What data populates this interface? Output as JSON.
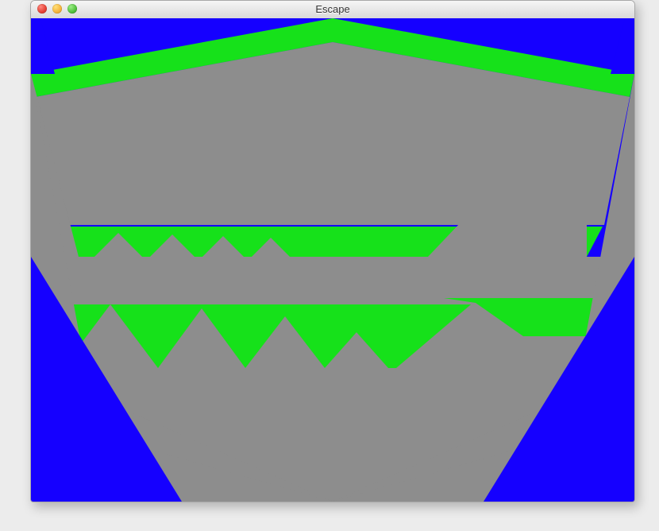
{
  "window": {
    "title": "Escape"
  },
  "traffic_lights": {
    "close": {
      "color": "#e33e32"
    },
    "minimize": {
      "color": "#f3b23a"
    },
    "zoom": {
      "color": "#4fbf3a"
    }
  },
  "scene": {
    "palette": {
      "sky": "#1500ff",
      "terrain": "#16e11a",
      "wall": "#8d8d8d"
    },
    "description": "Blocky 3D first-person maze view: green ground tiers with grey walls rising in perspective, bright blue sky/backdrop in the corners."
  }
}
